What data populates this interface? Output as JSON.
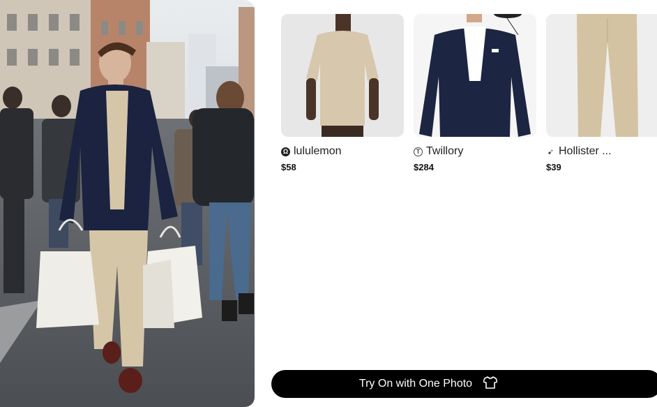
{
  "products": [
    {
      "brand": "lululemon",
      "price": "$58",
      "logo_icon": "lululemon-logo-icon",
      "logo_color": "#222222"
    },
    {
      "brand": "Twillory",
      "price": "$284",
      "logo_icon": "twillory-logo-icon",
      "logo_color": "#444444"
    },
    {
      "brand": "Hollister ...",
      "price": "$39",
      "logo_icon": "hollister-gull-icon",
      "logo_color": "#333333"
    }
  ],
  "cta": {
    "label": "Try On with One Photo",
    "icon": "tshirt-icon"
  },
  "colors": {
    "cta_bg": "#000000",
    "cta_text": "#ffffff",
    "navy": "#1b2340",
    "beige": "#d6c6a8"
  }
}
